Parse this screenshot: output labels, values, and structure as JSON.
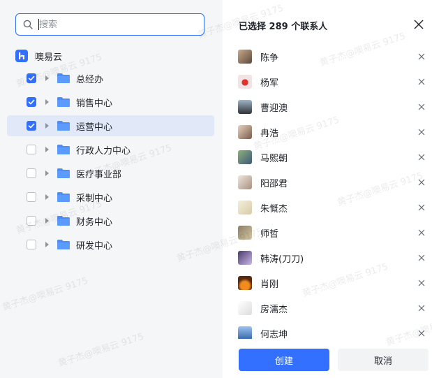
{
  "search": {
    "placeholder": "搜索"
  },
  "org": {
    "name": "噢易云"
  },
  "departments": [
    {
      "label": "总经办",
      "checked": true
    },
    {
      "label": "销售中心",
      "checked": true
    },
    {
      "label": "运营中心",
      "checked": true
    },
    {
      "label": "行政人力中心",
      "checked": false
    },
    {
      "label": "医疗事业部",
      "checked": false
    },
    {
      "label": "采制中心",
      "checked": false
    },
    {
      "label": "财务中心",
      "checked": false
    },
    {
      "label": "研发中心",
      "checked": false
    }
  ],
  "panel": {
    "title": "已选择 289 个联系人"
  },
  "contacts": [
    {
      "name": "陈争"
    },
    {
      "name": "杨军"
    },
    {
      "name": "曹迎澳"
    },
    {
      "name": "冉浩"
    },
    {
      "name": "马熙朝"
    },
    {
      "name": "阳邵君"
    },
    {
      "name": "朱慨杰"
    },
    {
      "name": "师哲"
    },
    {
      "name": "韩涛(刀刀)"
    },
    {
      "name": "肖刚"
    },
    {
      "name": "房濡杰"
    },
    {
      "name": "何志坤"
    }
  ],
  "actions": {
    "create_label": "创建",
    "cancel_label": "取消"
  },
  "watermark": {
    "text": "黄子杰@噢易云 9175"
  },
  "colors": {
    "accent": "#3370ff",
    "selected_row": "#e1e9f8",
    "left_bg": "#f5f6f7"
  }
}
